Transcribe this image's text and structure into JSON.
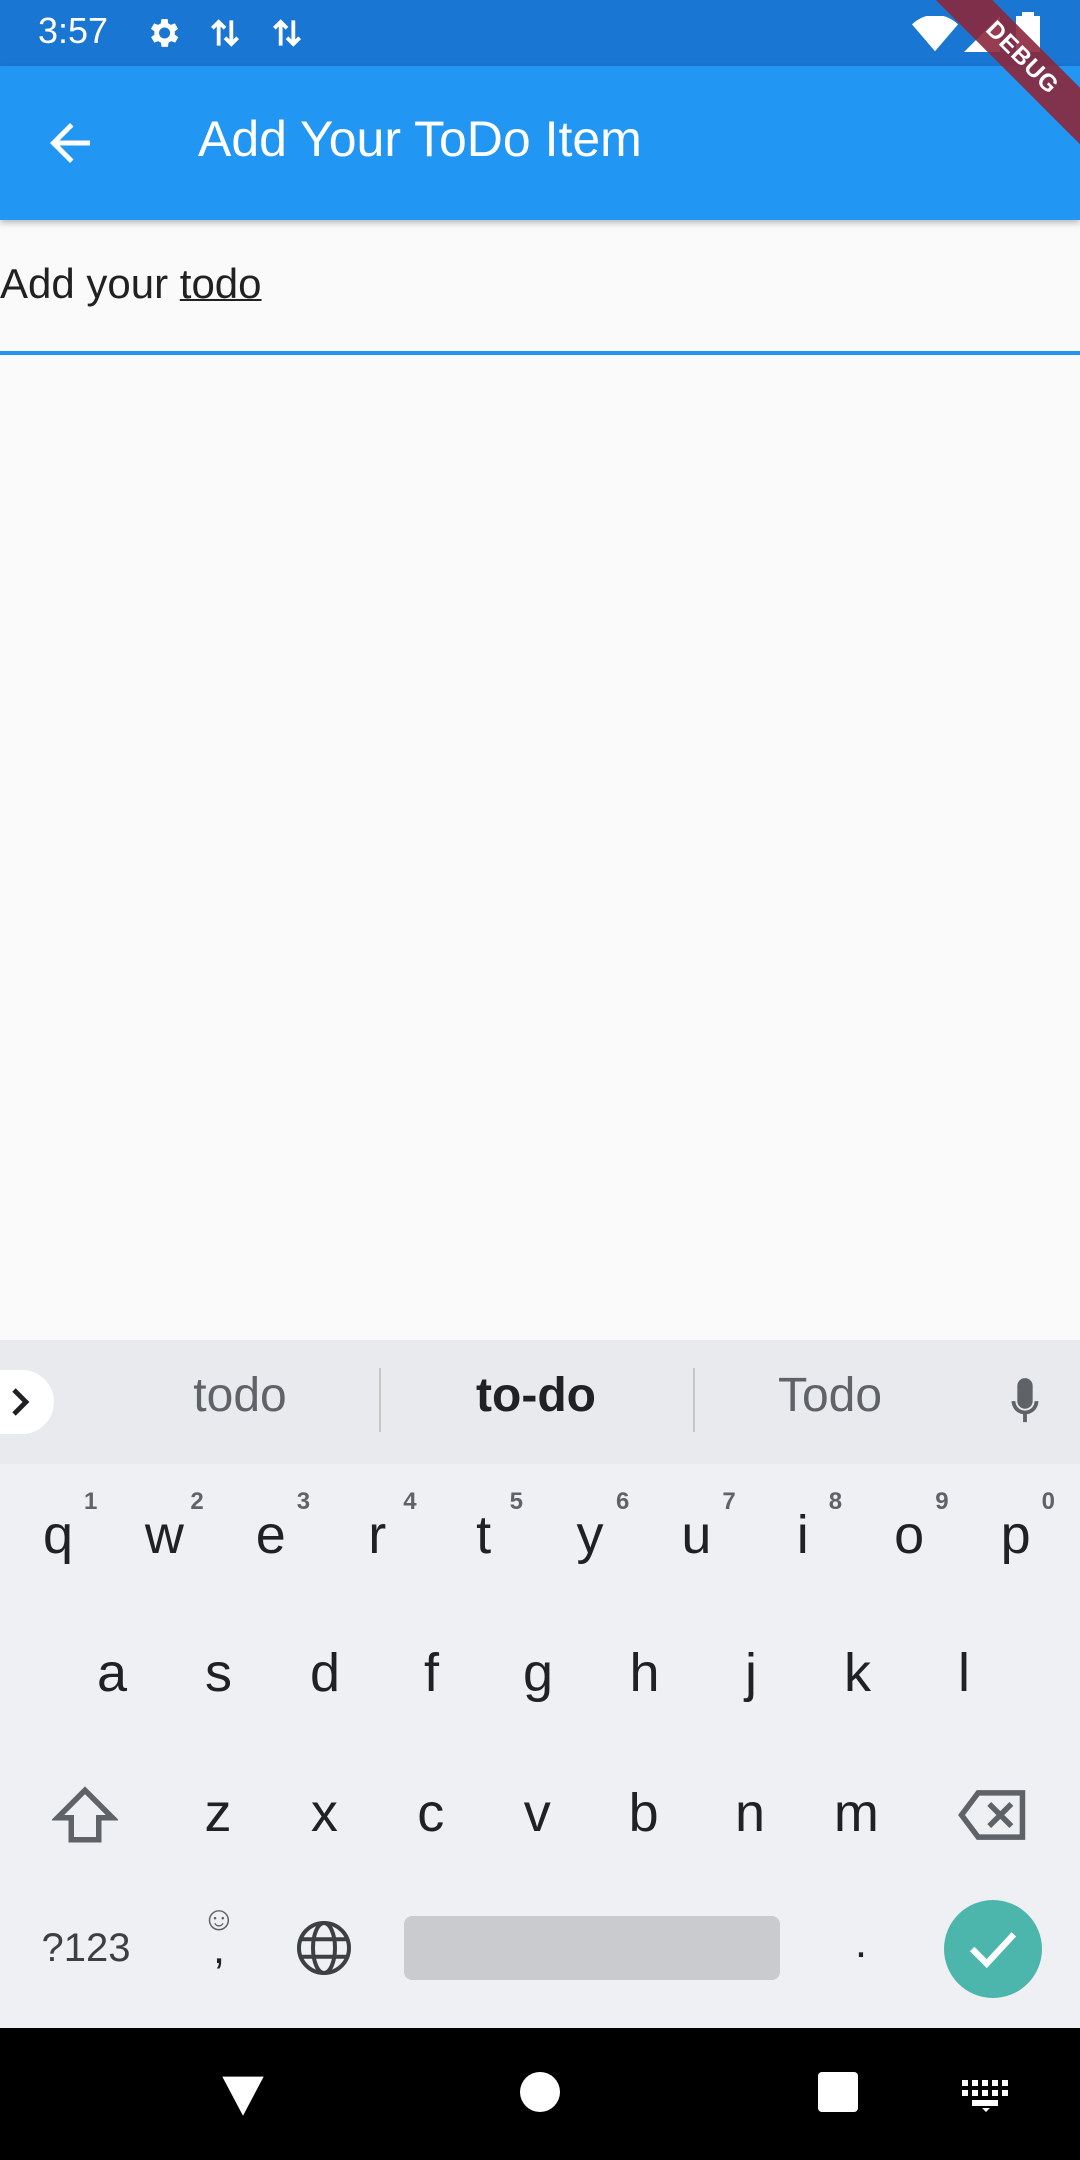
{
  "status_bar": {
    "time": "3:57",
    "icons": [
      "gear-icon",
      "data-transfer-icon",
      "data-transfer-icon",
      "wifi-icon",
      "signal-icon",
      "battery-icon"
    ]
  },
  "app_bar": {
    "title": "Add Your ToDo Item",
    "back_icon": "arrow-back-icon"
  },
  "debug_banner": {
    "label": "DEBUG"
  },
  "text_field": {
    "value_prefix": "Add your ",
    "value_underlined": "todo"
  },
  "keyboard": {
    "suggestions": [
      "todo",
      "to-do",
      "Todo"
    ],
    "row1": [
      {
        "k": "q",
        "h": "1"
      },
      {
        "k": "w",
        "h": "2"
      },
      {
        "k": "e",
        "h": "3"
      },
      {
        "k": "r",
        "h": "4"
      },
      {
        "k": "t",
        "h": "5"
      },
      {
        "k": "y",
        "h": "6"
      },
      {
        "k": "u",
        "h": "7"
      },
      {
        "k": "i",
        "h": "8"
      },
      {
        "k": "o",
        "h": "9"
      },
      {
        "k": "p",
        "h": "0"
      }
    ],
    "row2": [
      "a",
      "s",
      "d",
      "f",
      "g",
      "h",
      "j",
      "k",
      "l"
    ],
    "row3": [
      "z",
      "x",
      "c",
      "v",
      "b",
      "n",
      "m"
    ],
    "sym_label": "?123",
    "emoji_key": "☺",
    "comma_key": ",",
    "period_key": "."
  },
  "colors": {
    "primary": "#2196F3",
    "status": "#1976D2",
    "enter": "#4DB6AC"
  }
}
